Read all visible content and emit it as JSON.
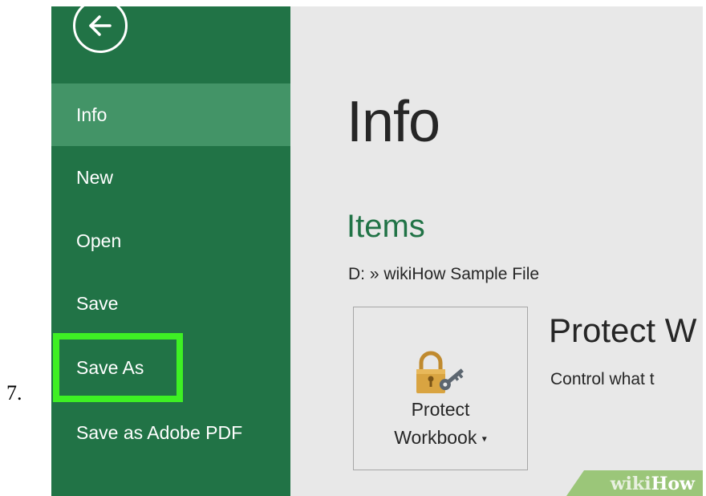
{
  "step": {
    "number": "7."
  },
  "backstage": {
    "menu": [
      {
        "label": "Info",
        "active": true
      },
      {
        "label": "New"
      },
      {
        "label": "Open"
      },
      {
        "label": "Save"
      },
      {
        "label": "Save As",
        "highlighted": true
      },
      {
        "label": "Save as Adobe PDF"
      }
    ]
  },
  "main": {
    "title": "Info",
    "section": "Items",
    "path": "D: » wikiHow Sample File",
    "protect": {
      "button_label_line1": "Protect",
      "button_label_line2": "Workbook",
      "dropdown_glyph": "▾",
      "heading": "Protect W",
      "description": "Control what t"
    }
  },
  "watermark": {
    "part1": "wiki",
    "part2": "How"
  },
  "colors": {
    "sidebar": "#217346",
    "active_item": "#439467",
    "highlight_box": "#3ef024",
    "content_bg": "#e8e8e8"
  },
  "icons": {
    "back": "back-arrow-icon",
    "protect": "lock-key-icon"
  }
}
